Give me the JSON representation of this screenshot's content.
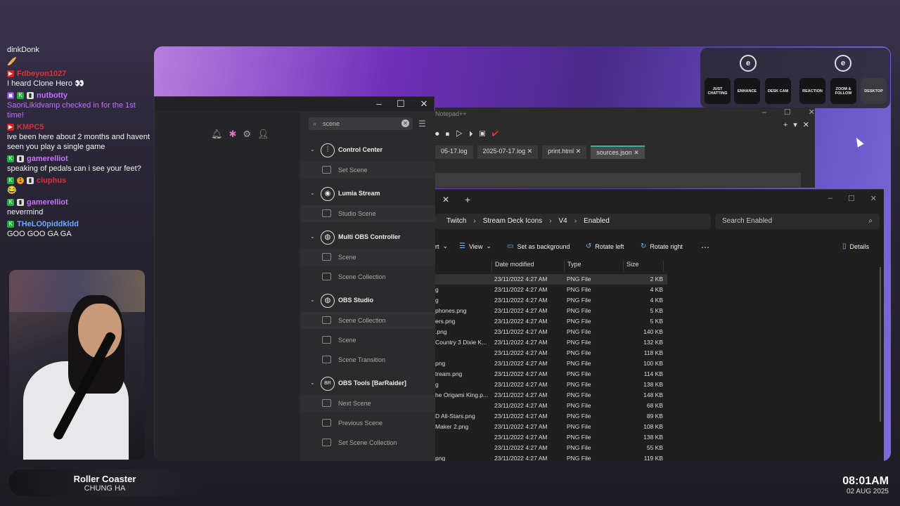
{
  "chat": {
    "messages": [
      {
        "user": "",
        "text": "dinkDonk",
        "color": "#ffffff",
        "badges": []
      },
      {
        "user": "",
        "text": "🥖",
        "color": "#ffffff",
        "badges": []
      },
      {
        "user": "Fdbeyon1027",
        "text": "I heard Clone Hero 👀",
        "color": "#e0303a",
        "badges": [
          "yt"
        ]
      },
      {
        "user": "nutbotty",
        "text": "SaoriLikidvamp checked in for the 1st time!",
        "color": "#c070ff",
        "badges": [
          "tw",
          "k",
          "w"
        ]
      },
      {
        "user": "KMPC5",
        "text": "ive been here about 2 months and havent seen you play a single game",
        "color": "#e0303a",
        "badges": [
          "yt"
        ]
      },
      {
        "user": "gamerelliot",
        "text": "speaking of pedals can i see your feet?",
        "color": "#d070ff",
        "badges": [
          "k",
          "w"
        ]
      },
      {
        "user": "ciuphus",
        "text": "😂",
        "color": "#e0303a",
        "badges": [
          "k",
          "o",
          "w"
        ]
      },
      {
        "user": "gamerelliot",
        "text": "nevermind",
        "color": "#d070ff",
        "badges": [
          "k",
          "w"
        ]
      },
      {
        "user": "THeLO0piddkldd",
        "text": "GOO GOO GA GA",
        "color": "#6fa8ff",
        "badges": [
          "k"
        ]
      }
    ]
  },
  "now_playing": {
    "title": "Roller Coaster",
    "artist": "CHUNG HA"
  },
  "clock": {
    "time": "08:01AM",
    "date": "02 AUG 2025"
  },
  "stream_deck_app": {
    "search_placeholder": "scene",
    "groups": [
      {
        "label": "Control Center",
        "icon": "sliders-icon",
        "items": [
          "Set Scene"
        ]
      },
      {
        "label": "Lumia Stream",
        "icon": "lumia-icon",
        "items": [
          "Studio Scene"
        ]
      },
      {
        "label": "Multi OBS Controller",
        "icon": "obs-icon",
        "items": [
          "Scene",
          "Scene Collection"
        ]
      },
      {
        "label": "OBS Studio",
        "icon": "obs-icon",
        "items": [
          "Scene Collection",
          "Scene",
          "Scene Transition"
        ]
      },
      {
        "label": "OBS Tools [BarRaider]",
        "icon": "barraider-icon",
        "items": [
          "Next Scene",
          "Previous Scene",
          "Set Scene Collection"
        ]
      }
    ]
  },
  "notepad": {
    "title": "Notepad++",
    "tabs": [
      "05-17.log",
      "2025-07-17.log",
      "print.html",
      "sources.json"
    ],
    "active_tab": "sources.json"
  },
  "explorer": {
    "breadcrumb": [
      "Twitch",
      "Stream Deck Icons",
      "V4",
      "Enabled"
    ],
    "search_placeholder": "Search Enabled",
    "commands": {
      "sort": "rt",
      "view": "View",
      "set_bg": "Set as background",
      "rot_left": "Rotate left",
      "rot_right": "Rotate right",
      "details": "Details"
    },
    "columns": [
      "Date modified",
      "Type",
      "Size"
    ],
    "rows": [
      {
        "name": "",
        "date": "23/11/2022 4:27 AM",
        "type": "PNG File",
        "size": "2 KB"
      },
      {
        "name": "g",
        "date": "23/11/2022 4:27 AM",
        "type": "PNG File",
        "size": "4 KB"
      },
      {
        "name": "g",
        "date": "23/11/2022 4:27 AM",
        "type": "PNG File",
        "size": "4 KB"
      },
      {
        "name": "phones.png",
        "date": "23/11/2022 4:27 AM",
        "type": "PNG File",
        "size": "5 KB"
      },
      {
        "name": "ers.png",
        "date": "23/11/2022 4:27 AM",
        "type": "PNG File",
        "size": "5 KB"
      },
      {
        "name": ".png",
        "date": "23/11/2022 4:27 AM",
        "type": "PNG File",
        "size": "140 KB"
      },
      {
        "name": "Country 3 Dixie K...",
        "date": "23/11/2022 4:27 AM",
        "type": "PNG File",
        "size": "132 KB"
      },
      {
        "name": "",
        "date": "23/11/2022 4:27 AM",
        "type": "PNG File",
        "size": "118 KB"
      },
      {
        "name": "png",
        "date": "23/11/2022 4:27 AM",
        "type": "PNG File",
        "size": "100 KB"
      },
      {
        "name": "tream.png",
        "date": "23/11/2022 4:27 AM",
        "type": "PNG File",
        "size": "114 KB"
      },
      {
        "name": "g",
        "date": "23/11/2022 4:27 AM",
        "type": "PNG File",
        "size": "138 KB"
      },
      {
        "name": "he Origami King.p...",
        "date": "23/11/2022 4:27 AM",
        "type": "PNG File",
        "size": "148 KB"
      },
      {
        "name": "",
        "date": "23/11/2022 4:27 AM",
        "type": "PNG File",
        "size": "68 KB"
      },
      {
        "name": "D All-Stars.png",
        "date": "23/11/2022 4:27 AM",
        "type": "PNG File",
        "size": "89 KB"
      },
      {
        "name": "Maker 2.png",
        "date": "23/11/2022 4:27 AM",
        "type": "PNG File",
        "size": "108 KB"
      },
      {
        "name": "",
        "date": "23/11/2022 4:27 AM",
        "type": "PNG File",
        "size": "138 KB"
      },
      {
        "name": "",
        "date": "23/11/2022 4:27 AM",
        "type": "PNG File",
        "size": "55 KB"
      },
      {
        "name": "png",
        "date": "23/11/2022 4:27 AM",
        "type": "PNG File",
        "size": "119 KB"
      }
    ]
  },
  "deck": {
    "keys": [
      "JUST CHATTING",
      "ENHANCE",
      "DESK CAM",
      "REACTION",
      "ZOOM & FOLLOW",
      "DESKTOP"
    ],
    "logo": "e"
  }
}
